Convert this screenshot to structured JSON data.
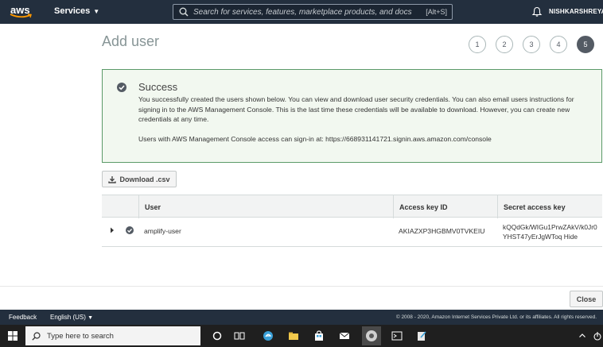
{
  "topnav": {
    "logo_text": "aws",
    "services_label": "Services",
    "search_placeholder": "Search for services, features, marketplace products, and docs",
    "search_shortcut": "[Alt+S]",
    "username": "NISHKARSHREYA"
  },
  "page": {
    "title": "Add user",
    "steps": [
      "1",
      "2",
      "3",
      "4",
      "5"
    ],
    "active_step": "5"
  },
  "success": {
    "title": "Success",
    "message": "You successfully created the users shown below. You can view and download user security credentials. You can also email users instructions for signing in to the AWS Management Console. This is the last time these credentials will be available to download. However, you can create new credentials at any time.",
    "signin_text": "Users with AWS Management Console access can sign-in at: https://668931141721.signin.aws.amazon.com/console"
  },
  "download_label": "Download .csv",
  "table": {
    "headers": {
      "user": "User",
      "access_key": "Access key ID",
      "secret_key": "Secret access key"
    },
    "rows": [
      {
        "user": "amplify-user",
        "access_key": "AKIAZXP3HGBMV0TVKEIU",
        "secret_key": "kQQdGk/WIGu1PrwZAkV/k0Jr0YHST47yErJgWToq",
        "hide_label": "Hide"
      }
    ]
  },
  "close_label": "Close",
  "footer": {
    "feedback": "Feedback",
    "language": "English (US)",
    "copyright": "© 2008 - 2020, Amazon Internet Services Private Ltd. or its affiliates. All rights reserved."
  },
  "taskbar": {
    "search_placeholder": "Type here to search"
  },
  "colors": {
    "nav_bg": "#232f3e",
    "success_border": "#5b9a68",
    "success_bg": "#f2f8f0",
    "active_step": "#545b64"
  }
}
